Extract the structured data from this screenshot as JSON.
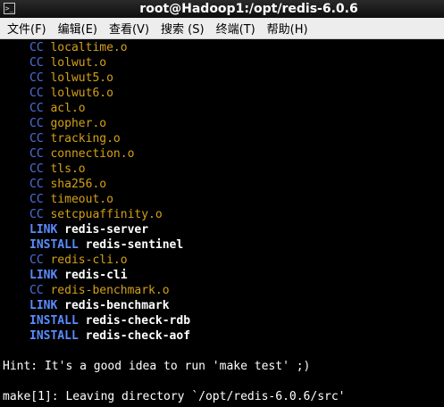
{
  "window": {
    "title": "root@Hadoop1:/opt/redis-6.0.6",
    "icon": "terminal-icon"
  },
  "menubar": {
    "items": [
      {
        "label": "文件(F)"
      },
      {
        "label": "编辑(E)"
      },
      {
        "label": "查看(V)"
      },
      {
        "label": "搜索 (S)"
      },
      {
        "label": "终端(T)"
      },
      {
        "label": "帮助(H)"
      }
    ]
  },
  "terminal": {
    "lines": [
      {
        "kind": "cc",
        "tag": "CC",
        "text": "localtime.o"
      },
      {
        "kind": "cc",
        "tag": "CC",
        "text": "lolwut.o"
      },
      {
        "kind": "cc",
        "tag": "CC",
        "text": "lolwut5.o"
      },
      {
        "kind": "cc",
        "tag": "CC",
        "text": "lolwut6.o"
      },
      {
        "kind": "cc",
        "tag": "CC",
        "text": "acl.o"
      },
      {
        "kind": "cc",
        "tag": "CC",
        "text": "gopher.o"
      },
      {
        "kind": "cc",
        "tag": "CC",
        "text": "tracking.o"
      },
      {
        "kind": "cc",
        "tag": "CC",
        "text": "connection.o"
      },
      {
        "kind": "cc",
        "tag": "CC",
        "text": "tls.o"
      },
      {
        "kind": "cc",
        "tag": "CC",
        "text": "sha256.o"
      },
      {
        "kind": "cc",
        "tag": "CC",
        "text": "timeout.o"
      },
      {
        "kind": "cc",
        "tag": "CC",
        "text": "setcpuaffinity.o"
      },
      {
        "kind": "link",
        "tag": "LINK",
        "text": "redis-server"
      },
      {
        "kind": "install",
        "tag": "INSTALL",
        "text": "redis-sentinel"
      },
      {
        "kind": "cc",
        "tag": "CC",
        "text": "redis-cli.o"
      },
      {
        "kind": "link",
        "tag": "LINK",
        "text": "redis-cli"
      },
      {
        "kind": "cc",
        "tag": "CC",
        "text": "redis-benchmark.o"
      },
      {
        "kind": "link",
        "tag": "LINK",
        "text": "redis-benchmark"
      },
      {
        "kind": "install",
        "tag": "INSTALL",
        "text": "redis-check-rdb"
      },
      {
        "kind": "install",
        "tag": "INSTALL",
        "text": "redis-check-aof"
      },
      {
        "kind": "blank",
        "text": ""
      },
      {
        "kind": "plain",
        "text": "Hint: It's a good idea to run 'make test' ;)"
      },
      {
        "kind": "blank",
        "text": ""
      },
      {
        "kind": "plain",
        "text": "make[1]: Leaving directory `/opt/redis-6.0.6/src'"
      }
    ]
  },
  "colors": {
    "cc_tag": "#4d6fdc",
    "object_file": "#d4a017",
    "link_install_tag": "#5a8cff",
    "text": "#ffffff",
    "background": "#000000"
  }
}
